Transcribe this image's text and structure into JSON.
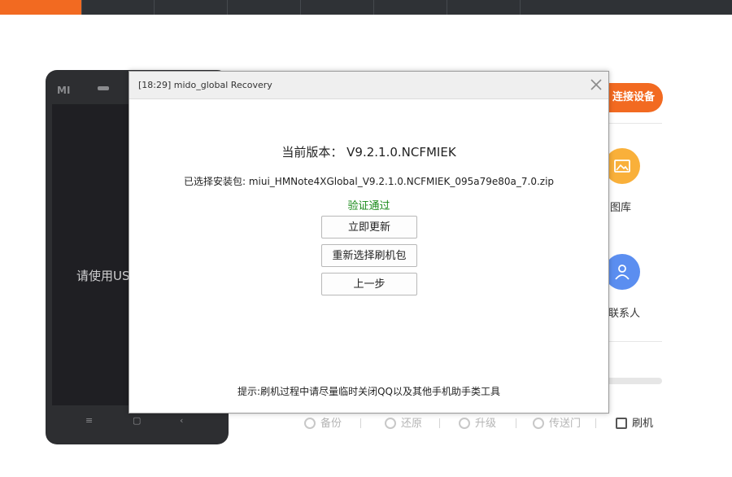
{
  "app": {
    "connect_button": "连接设备",
    "phone_brand": "MI",
    "phone_hint": "请使用USB",
    "sidebar": {
      "gallery_label": "图库",
      "contacts_label": "联系人"
    },
    "toolbar": {
      "backup": "备份",
      "restore": "还原",
      "upgrade": "升级",
      "transfer": "传送门",
      "flash": "刷机"
    },
    "colors": {
      "accent": "#f26a21",
      "gallery_circle": "#f9b03a",
      "contacts_circle": "#5b8ef0",
      "verified": "#1a8a1a"
    }
  },
  "dialog": {
    "title": "[18:29] mido_global Recovery",
    "version_label": "当前版本：",
    "version_value": "V9.2.1.0.NCFMIEK",
    "package_label": "已选择安装包:",
    "package_value": "miui_HMNote4XGlobal_V9.2.1.0.NCFMIEK_095a79e80a_7.0.zip",
    "status": "验证通过",
    "buttons": {
      "update_now": "立即更新",
      "reselect": "重新选择刷机包",
      "back": "上一步"
    },
    "tip": "提示:刷机过程中请尽量临时关闭QQ以及其他手机助手类工具"
  }
}
